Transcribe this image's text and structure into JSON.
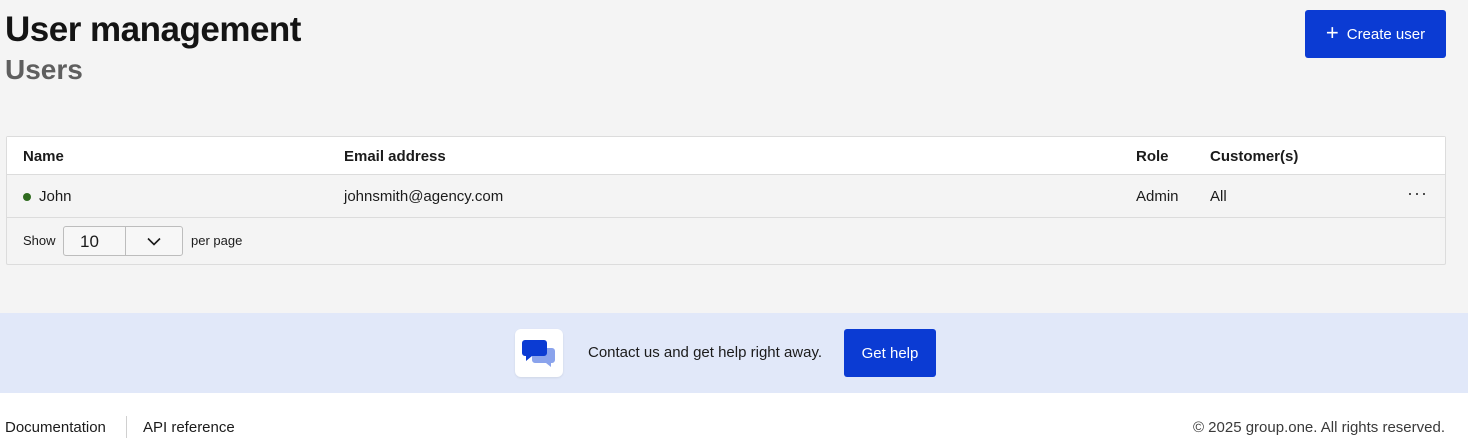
{
  "header": {
    "title": "User management",
    "subtitle": "Users",
    "create_button_label": "Create user"
  },
  "table": {
    "columns": {
      "name": "Name",
      "email": "Email address",
      "role": "Role",
      "customers": "Customer(s)"
    },
    "rows": [
      {
        "name": "John",
        "email": "johnsmith@agency.com",
        "role": "Admin",
        "customers": "All",
        "status_color": "#2f6b1f"
      }
    ],
    "pagination": {
      "show_label": "Show",
      "page_size": "10",
      "per_page_label": "per page"
    }
  },
  "help": {
    "text": "Contact us and get help right away.",
    "button_label": "Get help"
  },
  "footer": {
    "links": [
      "Documentation",
      "API reference"
    ],
    "copyright": "© 2025 group.one. All rights reserved."
  },
  "colors": {
    "accent": "#0b3bd3",
    "help_band": "#e1e8f9",
    "status_active": "#2f6b1f"
  },
  "icons": [
    "plus-icon",
    "more-icon",
    "chevron-down-icon",
    "chat-bubbles-icon"
  ]
}
